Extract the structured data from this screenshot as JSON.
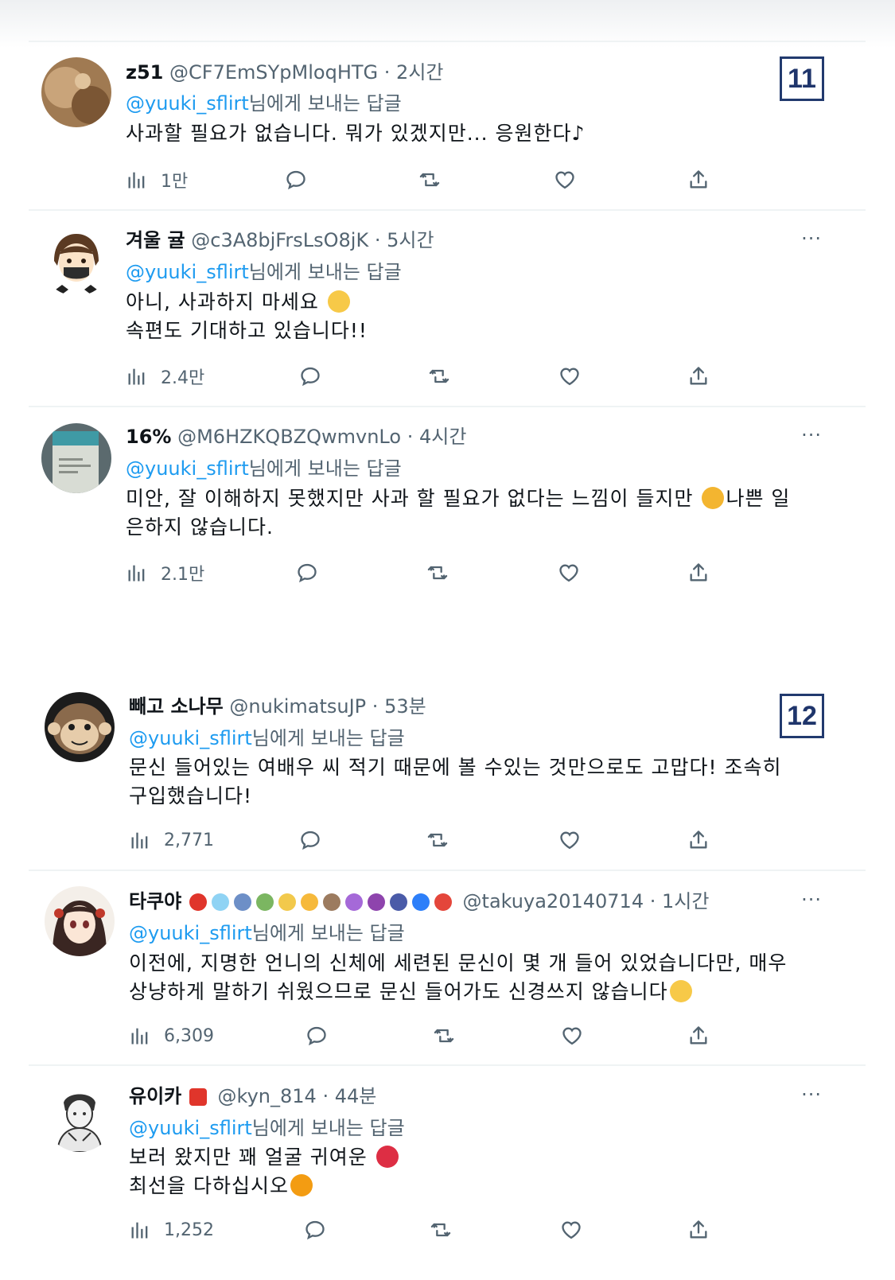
{
  "reply_prefix_suffix": "님에게 보내는 답글",
  "badges": [
    "11",
    "12"
  ],
  "more_label": "···",
  "tweets": [
    {
      "display_name": "z51",
      "handle": "@CF7EmSYpMloqHTG",
      "time": "2시간",
      "reply_to": "@yuuki_sflirt",
      "lines": [
        "사과할 필요가 없습니다. 뭐가 있겠지만... 응원한다♪"
      ],
      "views": "1만"
    },
    {
      "display_name": "겨울 귤",
      "handle": "@c3A8bjFrsLsO8jK",
      "time": "5시간",
      "reply_to": "@yuuki_sflirt",
      "lines": [
        "아니, 사과하지 마세요",
        "속편도 기대하고 있습니다!!"
      ],
      "views": "2.4만"
    },
    {
      "display_name": "16%",
      "handle": "@M6HZKQBZQwmvnLo",
      "time": "4시간",
      "reply_to": "@yuuki_sflirt",
      "lines": [
        "미안, 잘 이해하지 못했지만 사과 할 필요가 없다는 느낌이 들지만",
        "나쁜 일",
        "은하지 않습니다."
      ],
      "views": "2.1만"
    },
    {
      "display_name": "빼고 소나무",
      "handle": "@nukimatsuJP",
      "time": "53분",
      "reply_to": "@yuuki_sflirt",
      "lines": [
        "문신 들어있는 여배우 씨 적기 때문에 볼 수있는 것만으로도 고맙다! 조속히",
        "구입했습니다!"
      ],
      "views": "2,771"
    },
    {
      "display_name": "타쿠야",
      "handle": "@takuya20140714",
      "time": "1시간",
      "reply_to": "@yuuki_sflirt",
      "lines": [
        "이전에, 지명한 언니의 신체에 세련된 문신이 몇 개 들어 있었습니다만, 매우",
        "상냥하게 말하기 쉬웠으므로 문신 들어가도 신경쓰지 않습니다"
      ],
      "views": "6,309"
    },
    {
      "display_name": "유이카",
      "handle": "@kyn_814",
      "time": "44분",
      "reply_to": "@yuuki_sflirt",
      "lines": [
        "보러 왔지만 꽤 얼굴 귀여운",
        "최선을 다하십시오"
      ],
      "views": "1,252"
    }
  ],
  "colors": {
    "mention": "#1d9bf0",
    "secondary": "#536471",
    "badge_border": "#223a6e"
  },
  "icons": [
    "views-icon",
    "reply-icon",
    "retweet-icon",
    "like-icon",
    "share-icon",
    "more-icon"
  ]
}
